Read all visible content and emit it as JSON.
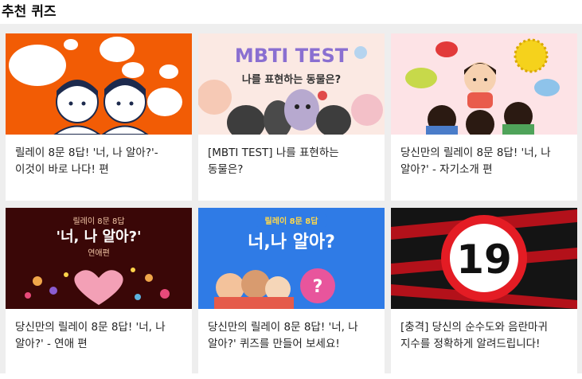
{
  "section": {
    "title": "추천 퀴즈"
  },
  "cards": [
    {
      "title": "릴레이 8문 8답! '너, 나 알아?'- 이것이 바로 나다! 편",
      "thumb_bg": "#f25c05"
    },
    {
      "title": "[MBTI TEST] 나를 표현하는 동물은?",
      "thumb_bg": "#fbe9e3",
      "thumb_text": {
        "headline": "MBTI TEST",
        "sub": "나를 표현하는 동물은?"
      }
    },
    {
      "title": "당신만의 릴레이 8문 8답! '너, 나 알아?' - 자기소개 편",
      "thumb_bg": "#fde3e6"
    },
    {
      "title": "당신만의 릴레이 8문 8답! '너, 나 알아?' - 연애 편",
      "thumb_bg": "#3a0707",
      "thumb_text": {
        "top": "릴레이 8문 8답",
        "headline": "'너, 나 알아?'",
        "sub": "연애편"
      }
    },
    {
      "title": "당신만의 릴레이 8문 8답! '너, 나 알아?' 퀴즈를 만들어 보세요!",
      "thumb_bg": "#2f7be6",
      "thumb_text": {
        "top": "릴레이 8문 8답",
        "headline": "너,나 알아?"
      }
    },
    {
      "title": "[충격] 당신의 순수도와 음란마귀 지수를 정확하게 알려드립니다!",
      "thumb_bg": "#141414",
      "thumb_text": {
        "badge": "19"
      }
    }
  ]
}
